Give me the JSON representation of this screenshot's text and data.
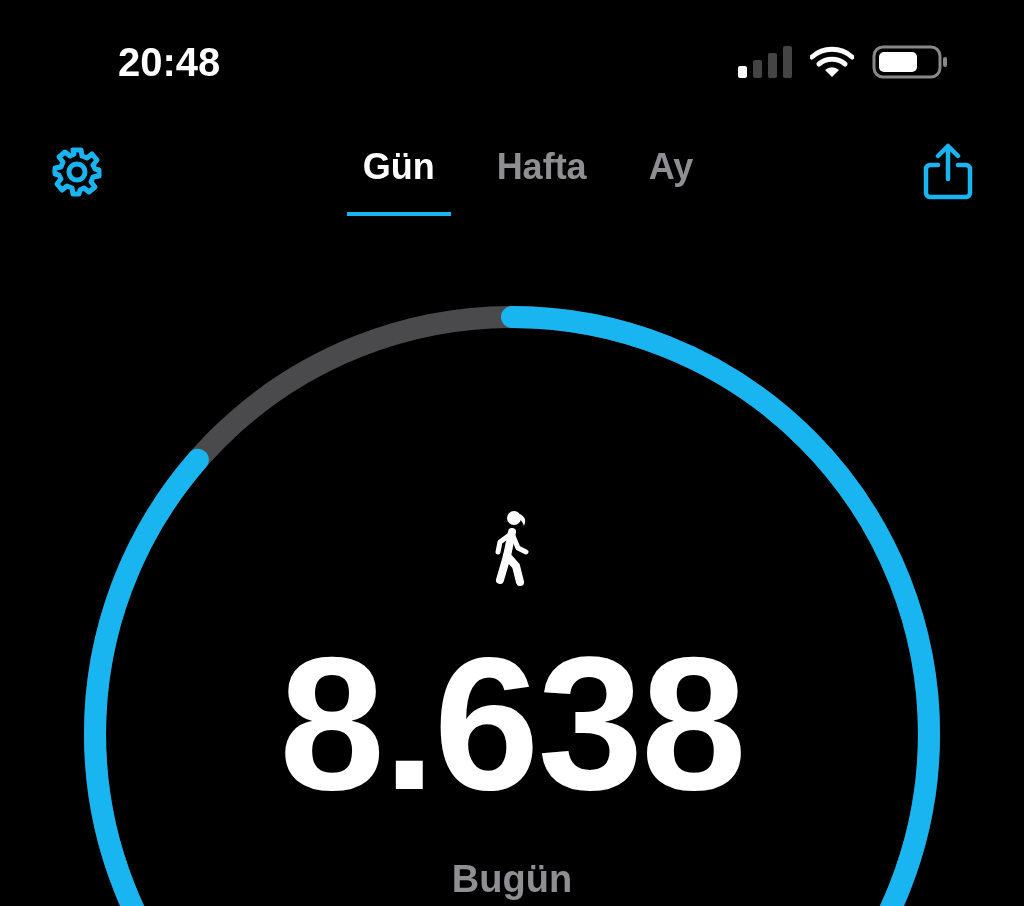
{
  "status_bar": {
    "time": "20:48"
  },
  "tabs": [
    {
      "label": "Gün",
      "selected": true
    },
    {
      "label": "Hafta",
      "selected": false
    },
    {
      "label": "Ay",
      "selected": false
    }
  ],
  "steps": {
    "count": "8.638",
    "caption": "Bugün"
  }
}
